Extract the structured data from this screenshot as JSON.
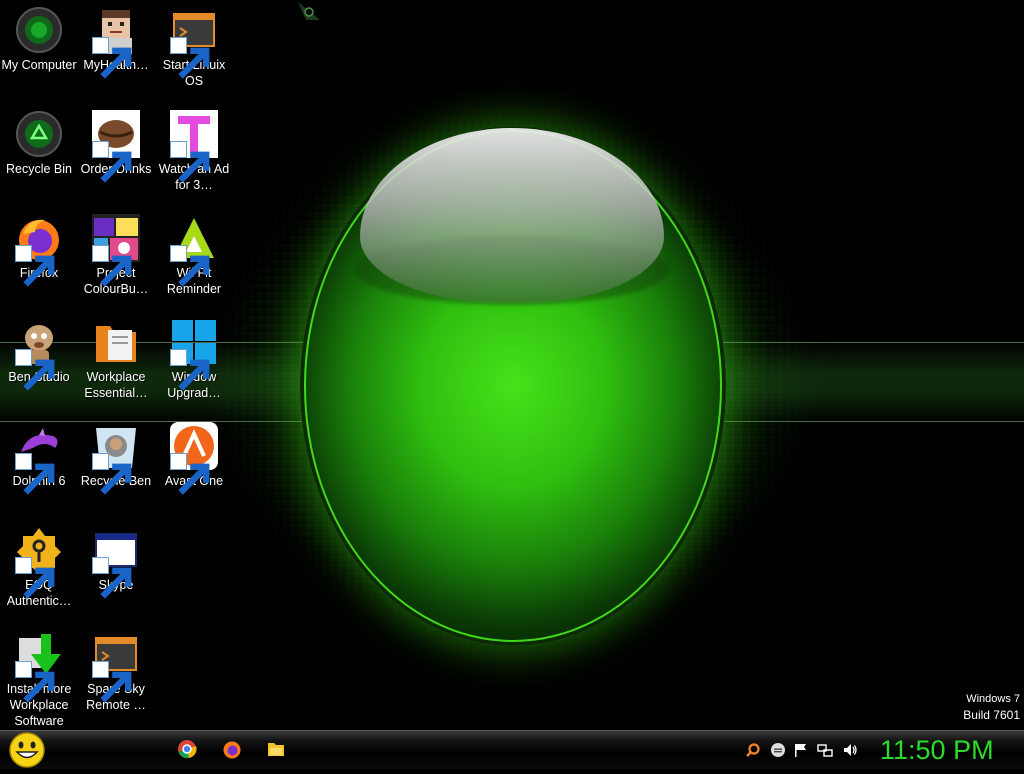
{
  "desktop": {
    "icons": [
      {
        "label": "My Computer",
        "icon": "my-computer-icon"
      },
      {
        "label": "MyHealth…",
        "icon": "myhealth-icon"
      },
      {
        "label": "Start Linuix OS",
        "icon": "linux-os-icon"
      },
      {
        "label": "Recycle Bin",
        "icon": "recycle-bin-icon"
      },
      {
        "label": "Order Drinks",
        "icon": "coffee-bean-icon"
      },
      {
        "label": "Watch an Ad for 3…",
        "icon": "ad-t-icon"
      },
      {
        "label": "Firefox",
        "icon": "firefox-icon"
      },
      {
        "label": "Project ColourBu…",
        "icon": "colour-collage-icon"
      },
      {
        "label": "Wii Fit Reminder",
        "icon": "wii-fit-icon"
      },
      {
        "label": "Ben Studio",
        "icon": "ben-dog-icon"
      },
      {
        "label": "Workplace Essential…",
        "icon": "workplace-folder-icon"
      },
      {
        "label": "Window Upgrad…",
        "icon": "windows-logo-icon"
      },
      {
        "label": "Dolphin 6",
        "icon": "dolphin-icon"
      },
      {
        "label": "Recycle Ben",
        "icon": "recycle-ben-icon"
      },
      {
        "label": "Avast One",
        "icon": "avast-icon"
      },
      {
        "label": "EOQ Authentic…",
        "icon": "key-badge-icon"
      },
      {
        "label": "Skype",
        "icon": "skype-window-icon"
      },
      {
        "label": "Install more Workplace Software",
        "icon": "install-arrow-icon"
      },
      {
        "label": "Spare Sky Remote …",
        "icon": "remote-terminal-icon"
      }
    ]
  },
  "windows_badge": {
    "version": "Windows 7",
    "build": "Build 7601"
  },
  "taskbar": {
    "start_icon": "smiley-start-icon",
    "pinned": [
      "chrome-icon",
      "firefox-icon",
      "file-explorer-icon"
    ],
    "tray": [
      "search-icon",
      "minus-circle-icon",
      "flag-icon",
      "network-icon",
      "volume-icon"
    ],
    "clock": "11:50 PM"
  },
  "colors": {
    "clock": "#2bdc2b",
    "orb": "#3fd41a",
    "background": "#000000"
  }
}
